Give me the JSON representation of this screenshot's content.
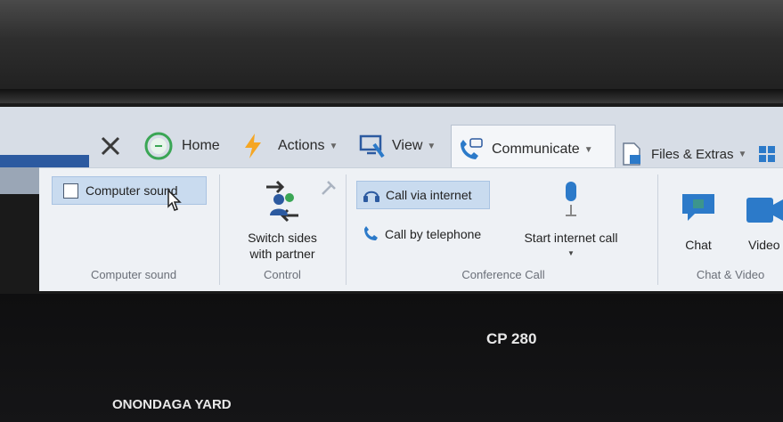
{
  "tabs": {
    "home": "Home",
    "actions": "Actions",
    "view": "View",
    "communicate": "Communicate",
    "files": "Files & Extras"
  },
  "ribbon": {
    "computer_sound": {
      "checkbox_label": "Computer sound",
      "checked": false,
      "group_label": "Computer sound"
    },
    "control": {
      "switch_label_1": "Switch sides",
      "switch_label_2": "with partner",
      "group_label": "Control"
    },
    "conference": {
      "call_via_internet": "Call via internet",
      "call_by_telephone": "Call by telephone",
      "start_internet_call": "Start internet call",
      "group_label": "Conference Call"
    },
    "chat_video": {
      "chat": "Chat",
      "video": "Video",
      "group_label": "Chat & Video"
    }
  },
  "remote_screen": {
    "label_1": "CP 280",
    "label_2": "ONONDAGA YARD"
  },
  "colors": {
    "accent": "#2c7ac9",
    "lightning": "#f5a623",
    "ribbon_bg": "#eef1f5",
    "highlight": "#c9dbef"
  }
}
